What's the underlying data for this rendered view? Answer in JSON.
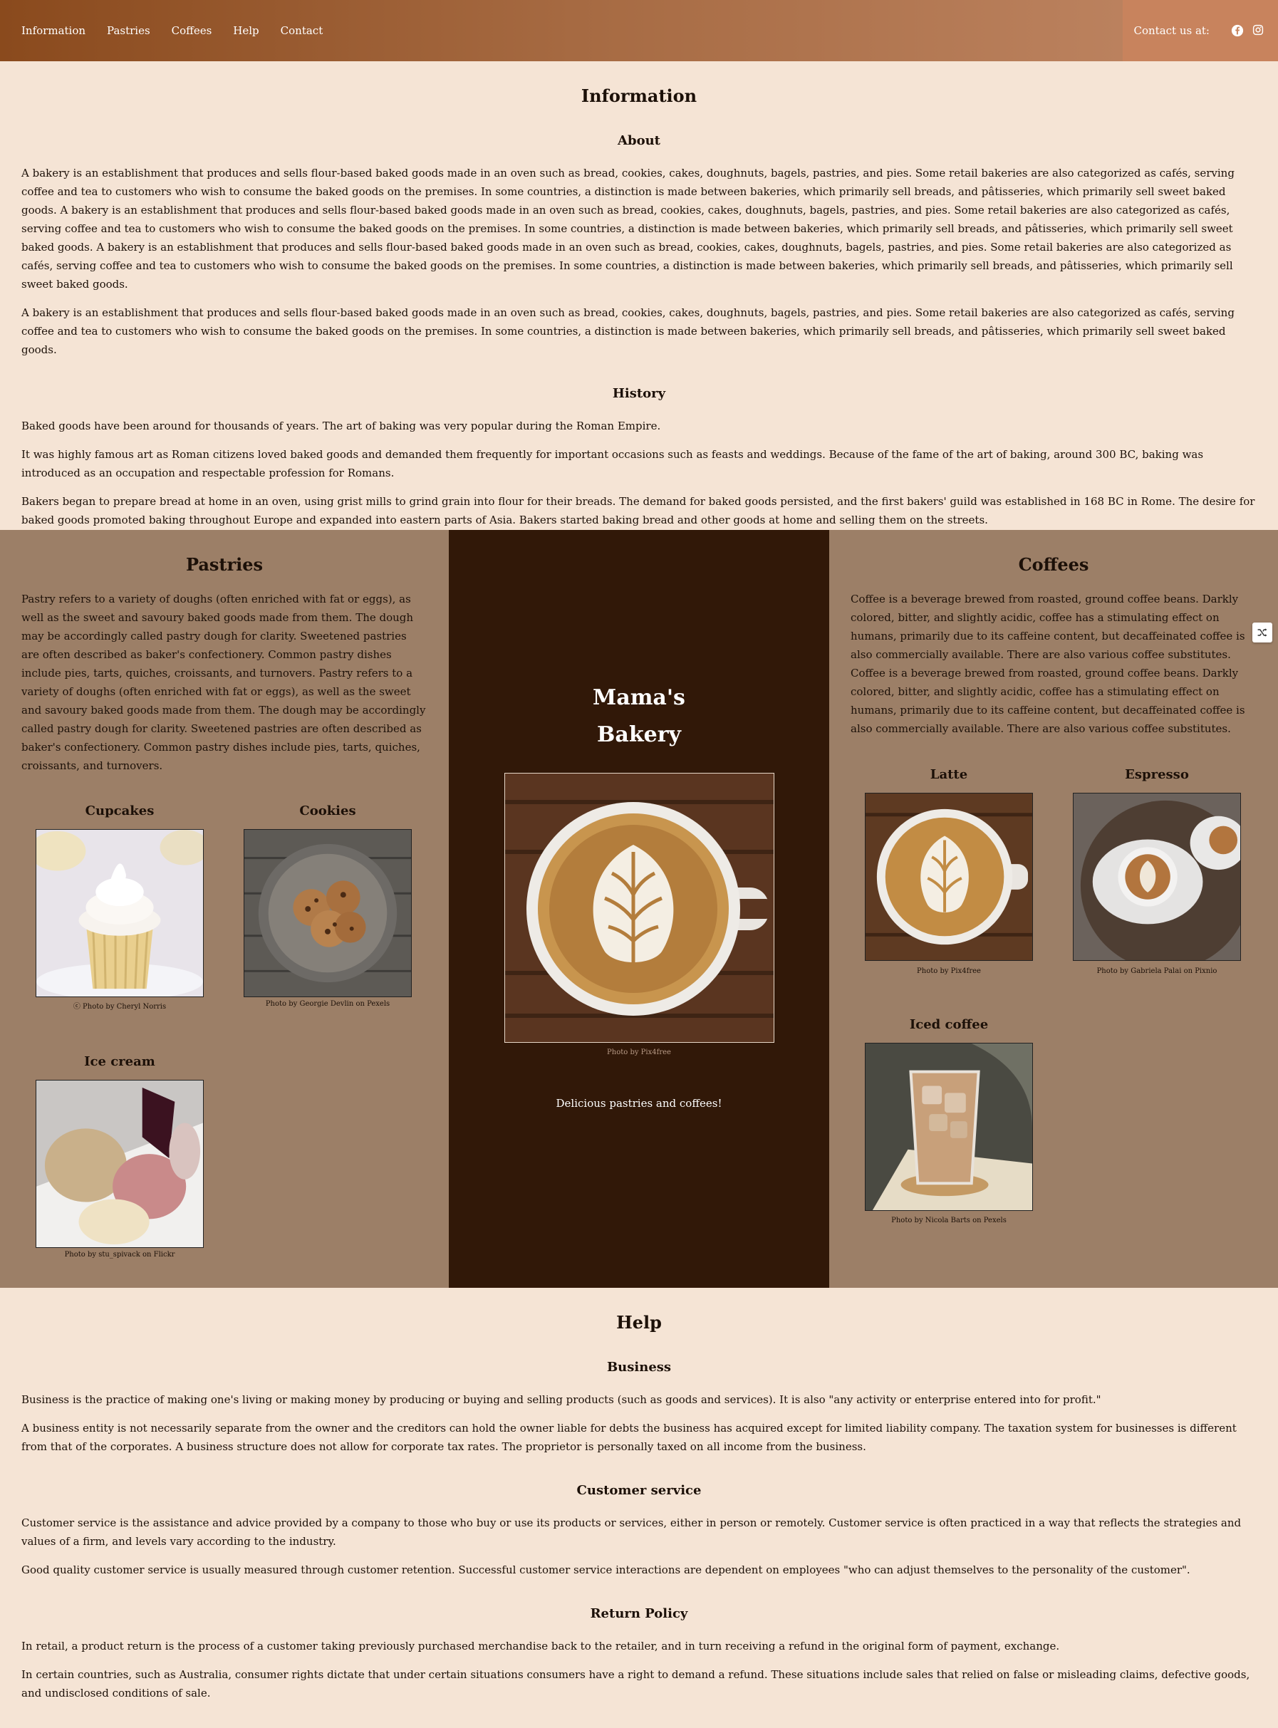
{
  "nav": {
    "links": [
      "Information",
      "Pastries",
      "Coffees",
      "Help",
      "Contact"
    ],
    "contact_label": "Contact us at:",
    "icons": [
      "facebook-icon",
      "instagram-icon"
    ]
  },
  "info": {
    "title": "Information",
    "about_title": "About",
    "about_p1": "A bakery is an establishment that produces and sells flour-based baked goods made in an oven such as bread, cookies, cakes, doughnuts, bagels, pastries, and pies. Some retail bakeries are also categorized as cafés, serving coffee and tea to customers who wish to consume the baked goods on the premises. In some countries, a distinction is made between bakeries, which primarily sell breads, and pâtisseries, which primarily sell sweet baked goods. A bakery is an establishment that produces and sells flour-based baked goods made in an oven such as bread, cookies, cakes, doughnuts, bagels, pastries, and pies. Some retail bakeries are also categorized as cafés, serving coffee and tea to customers who wish to consume the baked goods on the premises. In some countries, a distinction is made between bakeries, which primarily sell breads, and pâtisseries, which primarily sell sweet baked goods. A bakery is an establishment that produces and sells flour-based baked goods made in an oven such as bread, cookies, cakes, doughnuts, bagels, pastries, and pies. Some retail bakeries are also categorized as cafés, serving coffee and tea to customers who wish to consume the baked goods on the premises. In some countries, a distinction is made between bakeries, which primarily sell breads, and pâtisseries, which primarily sell sweet baked goods.",
    "about_p2": "A bakery is an establishment that produces and sells flour-based baked goods made in an oven such as bread, cookies, cakes, doughnuts, bagels, pastries, and pies. Some retail bakeries are also categorized as cafés, serving coffee and tea to customers who wish to consume the baked goods on the premises. In some countries, a distinction is made between bakeries, which primarily sell breads, and pâtisseries, which primarily sell sweet baked goods.",
    "history_title": "History",
    "history_p1": "Baked goods have been around for thousands of years. The art of baking was very popular during the Roman Empire.",
    "history_p2": "It was highly famous art as Roman citizens loved baked goods and demanded them frequently for important occasions such as feasts and weddings. Because of the fame of the art of baking, around 300 BC, baking was introduced as an occupation and respectable profession for Romans.",
    "history_p3": "Bakers began to prepare bread at home in an oven, using grist mills to grind grain into flour for their breads. The demand for baked goods persisted, and the first bakers' guild was established in 168 BC in Rome. The desire for baked goods promoted baking throughout Europe and expanded into eastern parts of Asia. Bakers started baking bread and other goods at home and selling them on the streets."
  },
  "pastries": {
    "title": "Pastries",
    "text": "Pastry refers to a variety of doughs (often enriched with fat or eggs), as well as the sweet and savoury baked goods made from them. The dough may be accordingly called pastry dough for clarity. Sweetened pastries are often described as baker's confectionery. Common pastry dishes include pies, tarts, quiches, croissants, and turnovers. Pastry refers to a variety of doughs (often enriched with fat or eggs), as well as the sweet and savoury baked goods made from them. The dough may be accordingly called pastry dough for clarity. Sweetened pastries are often described as baker's confectionery. Common pastry dishes include pies, tarts, quiches, croissants, and turnovers.",
    "items": [
      {
        "name": "Cupcakes",
        "caption": "ⓒ Photo by Cheryl Norris"
      },
      {
        "name": "Cookies",
        "caption": "Photo by Georgie Devlin on Pexels"
      },
      {
        "name": "Ice cream",
        "caption": "Photo by stu_spivack on Flickr"
      }
    ]
  },
  "center": {
    "title_line1": "Mama's",
    "title_line2": "Bakery",
    "caption": "Photo by Pix4free",
    "tagline": "Delicious pastries and coffees!"
  },
  "coffees": {
    "title": "Coffees",
    "text": "Coffee is a beverage brewed from roasted, ground coffee beans. Darkly colored, bitter, and slightly acidic, coffee has a stimulating effect on humans, primarily due to its caffeine content, but decaffeinated coffee is also commercially available. There are also various coffee substitutes. Coffee is a beverage brewed from roasted, ground coffee beans. Darkly colored, bitter, and slightly acidic, coffee has a stimulating effect on humans, primarily due to its caffeine content, but decaffeinated coffee is also commercially available. There are also various coffee substitutes.",
    "items": [
      {
        "name": "Latte",
        "caption": "Photo by Pix4free"
      },
      {
        "name": "Espresso",
        "caption": "Photo by Gabriela Palai on Pixnio"
      },
      {
        "name": "Iced coffee",
        "caption": "Photo by Nicola Barts on Pexels"
      }
    ]
  },
  "help": {
    "title": "Help",
    "business_title": "Business",
    "business_p1": "Business is the practice of making one's living or making money by producing or buying and selling products (such as goods and services). It is also \"any activity or enterprise entered into for profit.\"",
    "business_p2": "A business entity is not necessarily separate from the owner and the creditors can hold the owner liable for debts the business has acquired except for limited liability company. The taxation system for businesses is different from that of the corporates. A business structure does not allow for corporate tax rates. The proprietor is personally taxed on all income from the business.",
    "cs_title": "Customer service",
    "cs_p1": "Customer service is the assistance and advice provided by a company to those who buy or use its products or services, either in person or remotely. Customer service is often practiced in a way that reflects the strategies and values of a firm, and levels vary according to the industry.",
    "cs_p2": "Good quality customer service is usually measured through customer retention. Successful customer service interactions are dependent on employees \"who can adjust themselves to the personality of the customer\".",
    "return_title": "Return Policy",
    "return_p1": "In retail, a product return is the process of a customer taking previously purchased merchandise back to the retailer, and in turn receiving a refund in the original form of payment, exchange.",
    "return_p2": "In certain countries, such as Australia, consumer rights dictate that under certain situations consumers have a right to demand a refund. These situations include sales that relied on false or misleading claims, defective goods, and undisclosed conditions of sale."
  },
  "colors": {
    "page_bg": "#f5e4d5",
    "panel_bg": "#9c7f67",
    "center_bg": "#311808",
    "nav_start": "#8a4a1d",
    "nav_end": "#c18866",
    "contact_bg": "#c8835d"
  }
}
